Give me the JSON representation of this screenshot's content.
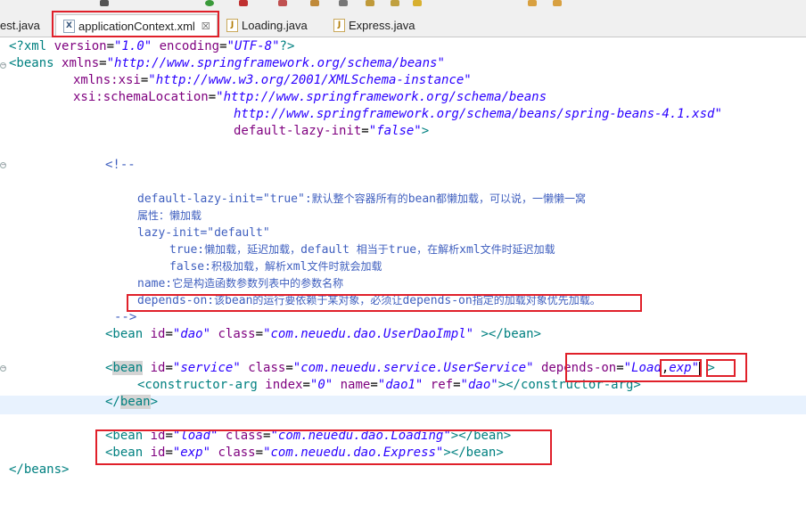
{
  "tabs": [
    {
      "label": "est.java",
      "icon": "java-file-icon"
    },
    {
      "label": "applicationContext.xml",
      "icon": "xml-file-icon",
      "close": "☒"
    },
    {
      "label": "Loading.java",
      "icon": "java-file-icon"
    },
    {
      "label": "Express.java",
      "icon": "java-file-icon"
    }
  ],
  "code": {
    "l1": {
      "a": "<?xml ",
      "b": "version",
      "c": "=",
      "d": "\"1.0\"",
      "e": " ",
      "f": "encoding",
      "g": "=",
      "h": "\"UTF-8\"",
      "i": "?>"
    },
    "l2": {
      "a": "<beans ",
      "b": "xmlns",
      "c": "=",
      "d": "\"http://www.springframework.org/schema/beans\""
    },
    "l3": {
      "b": "xmlns:xsi",
      "c": "=",
      "d": "\"http://www.w3.org/2001/XMLSchema-instance\""
    },
    "l4": {
      "b": "xsi:schemaLocation",
      "c": "=",
      "d": "\"http://www.springframework.org/schema/beans"
    },
    "l5": {
      "d": "http://www.springframework.org/schema/beans/spring-beans-4.1.xsd\""
    },
    "l6": {
      "b": "default-lazy-init",
      "c": "=",
      "d": "\"false\"",
      "e": ">"
    },
    "c_open": "<!--",
    "c1": {
      "a": "default-lazy-init=\"true\":",
      "b": "默认整个容器所有的",
      "c": "bean",
      "d": "都懒加载，可以说，一懒懒一窝"
    },
    "c2": "属性：懒加载",
    "c3": "lazy-init=\"default\"",
    "c4": {
      "a": "true:",
      "b": "懒加载，延迟加载，",
      "c": "default ",
      "d": "相当于",
      "e": "true",
      "f": "，在解析",
      "g": "xml",
      "h": "文件时延迟加载"
    },
    "c5": {
      "a": "false:",
      "b": "积极加载，解析",
      "c": "xml",
      "d": "文件时就会加载"
    },
    "c6": {
      "a": "name:",
      "b": "它是构造函数参数列表中的参数名称"
    },
    "c7": {
      "a": "depends-on:",
      "b": "该",
      "c": "bean",
      "d": "的运行要依赖于某对象，必须让",
      "e": "depends-on",
      "f": "指定的加载对象优先加载。"
    },
    "c_close": "-->",
    "b1": {
      "a": "<bean ",
      "b": "id",
      "c": "=",
      "d": "\"dao\"",
      "e": " ",
      "f": "class",
      "g": "=",
      "h": "\"com.neuedu.dao.UserDaoImpl\"",
      "i": " ></bean>"
    },
    "b2": {
      "a0": "<",
      "a1": "bean",
      "a2": " ",
      "b": "id",
      "c": "=",
      "d": "\"service\"",
      "e": " ",
      "f": "class",
      "g": "=",
      "h": "\"com.neuedu.service.UserService\"",
      "i": " ",
      "j": "depends-on",
      "k": "=",
      "l": "\"Load",
      "m": ",",
      "n": "exp",
      "o": "\"",
      "p": " >"
    },
    "b3": {
      "a": "<constructor-arg ",
      "b": "index",
      "c": "=",
      "d": "\"0\"",
      "e": " ",
      "f": "name",
      "g": "=",
      "h": "\"dao1\"",
      "i": " ",
      "j": "ref",
      "k": "=",
      "l": "\"dao\"",
      "m": "></constructor-arg>"
    },
    "b4": {
      "a": "</",
      "b": "bean",
      "c": ">"
    },
    "b5": {
      "a": "<bean ",
      "b": "id",
      "c": "=",
      "d": "\"load\"",
      "e": " ",
      "f": "class",
      "g": "=",
      "h": "\"com.neuedu.dao.Loading\"",
      "i": "></bean>"
    },
    "b6": {
      "a": "<bean ",
      "b": "id",
      "c": "=",
      "d": "\"exp\"",
      "e": " ",
      "f": "class",
      "g": "=",
      "h": "\"com.neuedu.dao.Express\"",
      "i": "></bean>"
    },
    "end": "</beans>"
  },
  "colors": {
    "highlight_box": "#e0202a",
    "tag": "#008080",
    "attr": "#7f007f",
    "value": "#2a00ff",
    "comment": "#3f5fbf"
  }
}
